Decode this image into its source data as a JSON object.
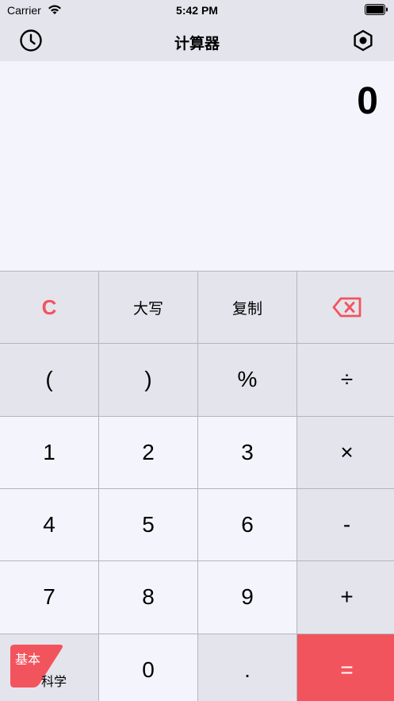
{
  "status_bar": {
    "carrier": "Carrier",
    "time": "5:42 PM"
  },
  "nav": {
    "title": "计算器",
    "history_icon": "clock-icon",
    "settings_icon": "hexagon-gear-icon"
  },
  "display": {
    "value": "0"
  },
  "keys": {
    "clear": "C",
    "uppercase": "大写",
    "copy": "复制",
    "backspace_icon": "backspace-icon",
    "lparen": "(",
    "rparen": ")",
    "percent": "%",
    "divide": "÷",
    "one": "1",
    "two": "2",
    "three": "3",
    "multiply": "×",
    "four": "4",
    "five": "5",
    "six": "6",
    "minus": "-",
    "seven": "7",
    "eight": "8",
    "nine": "9",
    "plus": "+",
    "zero": "0",
    "dot": ".",
    "equals": "="
  },
  "mode": {
    "basic": "基本",
    "scientific": "科学"
  },
  "colors": {
    "accent": "#f2545d",
    "key_light": "#f4f4fd",
    "key_gray": "#e4e4ec",
    "divider": "#b5b5bb"
  }
}
